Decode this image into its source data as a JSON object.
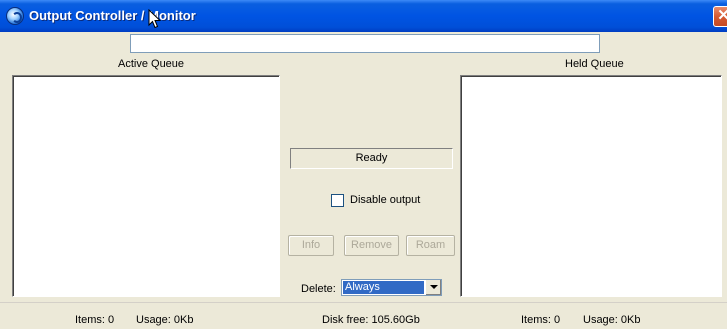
{
  "window": {
    "title": "Output Controller / Monitor",
    "close_glyph": "✕"
  },
  "top_input": {
    "value": ""
  },
  "active_queue": {
    "label": "Active Queue",
    "items": []
  },
  "held_queue": {
    "label": "Held Queue",
    "items": []
  },
  "center": {
    "status": "Ready",
    "disable_output": {
      "label": "Disable output",
      "checked": false
    },
    "buttons": {
      "info": "Info",
      "remove": "Remove",
      "roam": "Roam"
    },
    "delete": {
      "label": "Delete:",
      "value": "Always"
    }
  },
  "statusbar": {
    "active_items": "Items:  0",
    "active_usage": "Usage: 0Kb",
    "disk_free": "Disk free: 105.60Gb",
    "held_items": "Items:  0",
    "held_usage": "Usage: 0Kb"
  },
  "colors": {
    "titlebar": "#0054e3",
    "window_face": "#ece9d8",
    "selection": "#316ac5",
    "close_button": "#d65a32"
  },
  "icons": [
    "app-icon",
    "close-icon",
    "dropdown-arrow-icon",
    "mouse-cursor-icon"
  ]
}
